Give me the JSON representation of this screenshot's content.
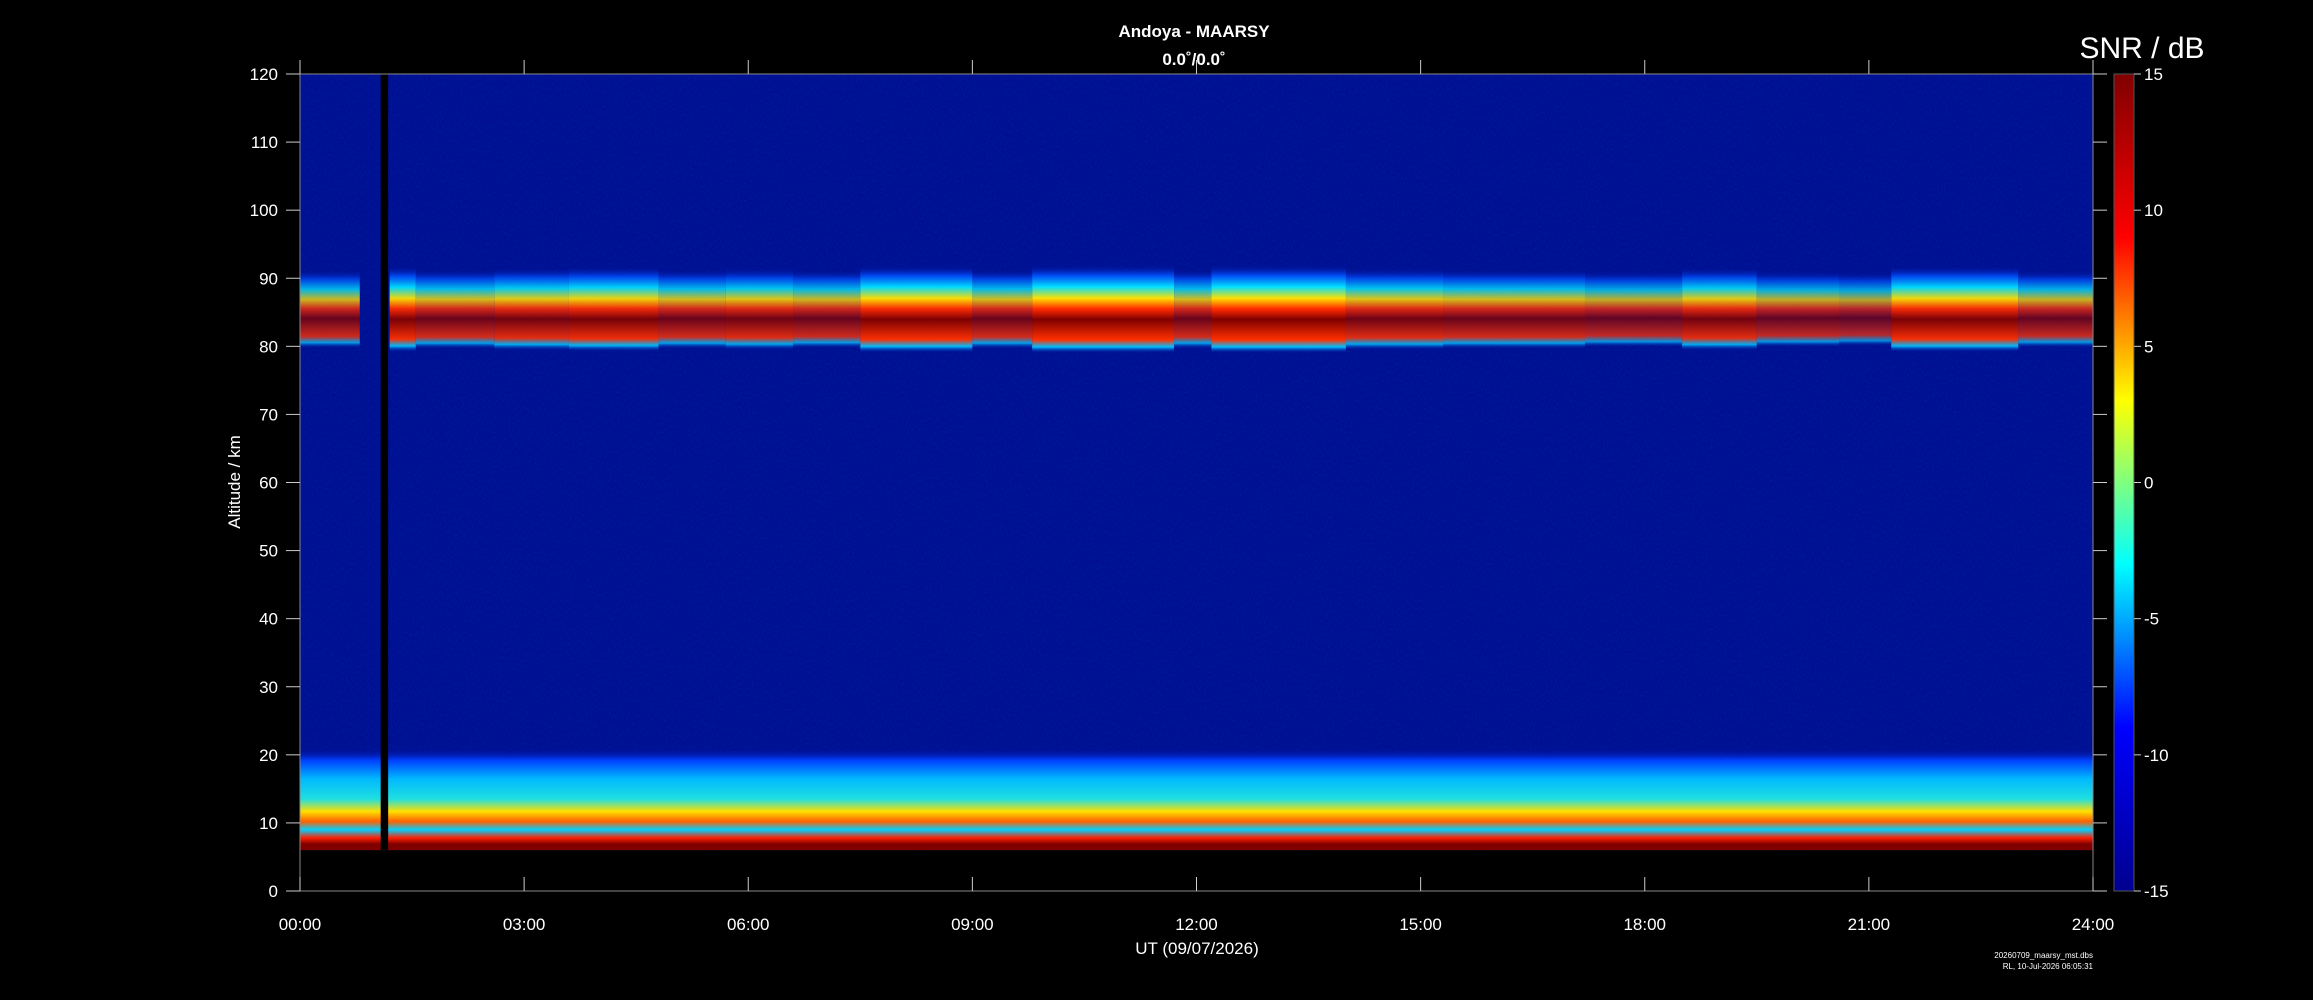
{
  "chart_data": {
    "type": "heatmap",
    "title": "Andoya - MAARSY",
    "subtitle": "0.0˚/0.0˚",
    "xlabel": "UT (09/07/2026)",
    "ylabel": "Altitude / km",
    "colorbar_label": "SNR / dB",
    "x_ticks": [
      "00:00",
      "03:00",
      "06:00",
      "09:00",
      "12:00",
      "15:00",
      "18:00",
      "21:00",
      "24:00"
    ],
    "xlim_hours": [
      0,
      24
    ],
    "y_ticks": [
      0,
      10,
      20,
      30,
      40,
      50,
      60,
      70,
      80,
      90,
      100,
      110,
      120
    ],
    "ylim_km": [
      0,
      120
    ],
    "colorbar_ticks": [
      15,
      10,
      5,
      0,
      -5,
      -10,
      -15
    ],
    "clim_db": [
      -15,
      15
    ],
    "colormap": "jet",
    "colormap_stops": [
      "#00008f",
      "#0000ff",
      "#00ffff",
      "#ffff00",
      "#ff0000",
      "#800000"
    ],
    "data_gap_hours": [
      1.08,
      1.18
    ],
    "data_coverage_km": [
      6,
      120
    ],
    "features": [
      {
        "label": "mesospheric echo layer",
        "altitude_km": [
          79,
          92
        ],
        "peak_db": 15
      },
      {
        "label": "lower atmosphere echoes",
        "altitude_km": [
          6,
          21
        ],
        "peak_db": 15
      }
    ],
    "footer": [
      "20260709_maarsy_mst.dbs",
      "RL, 10-Jul-2026 06:05:31"
    ]
  }
}
